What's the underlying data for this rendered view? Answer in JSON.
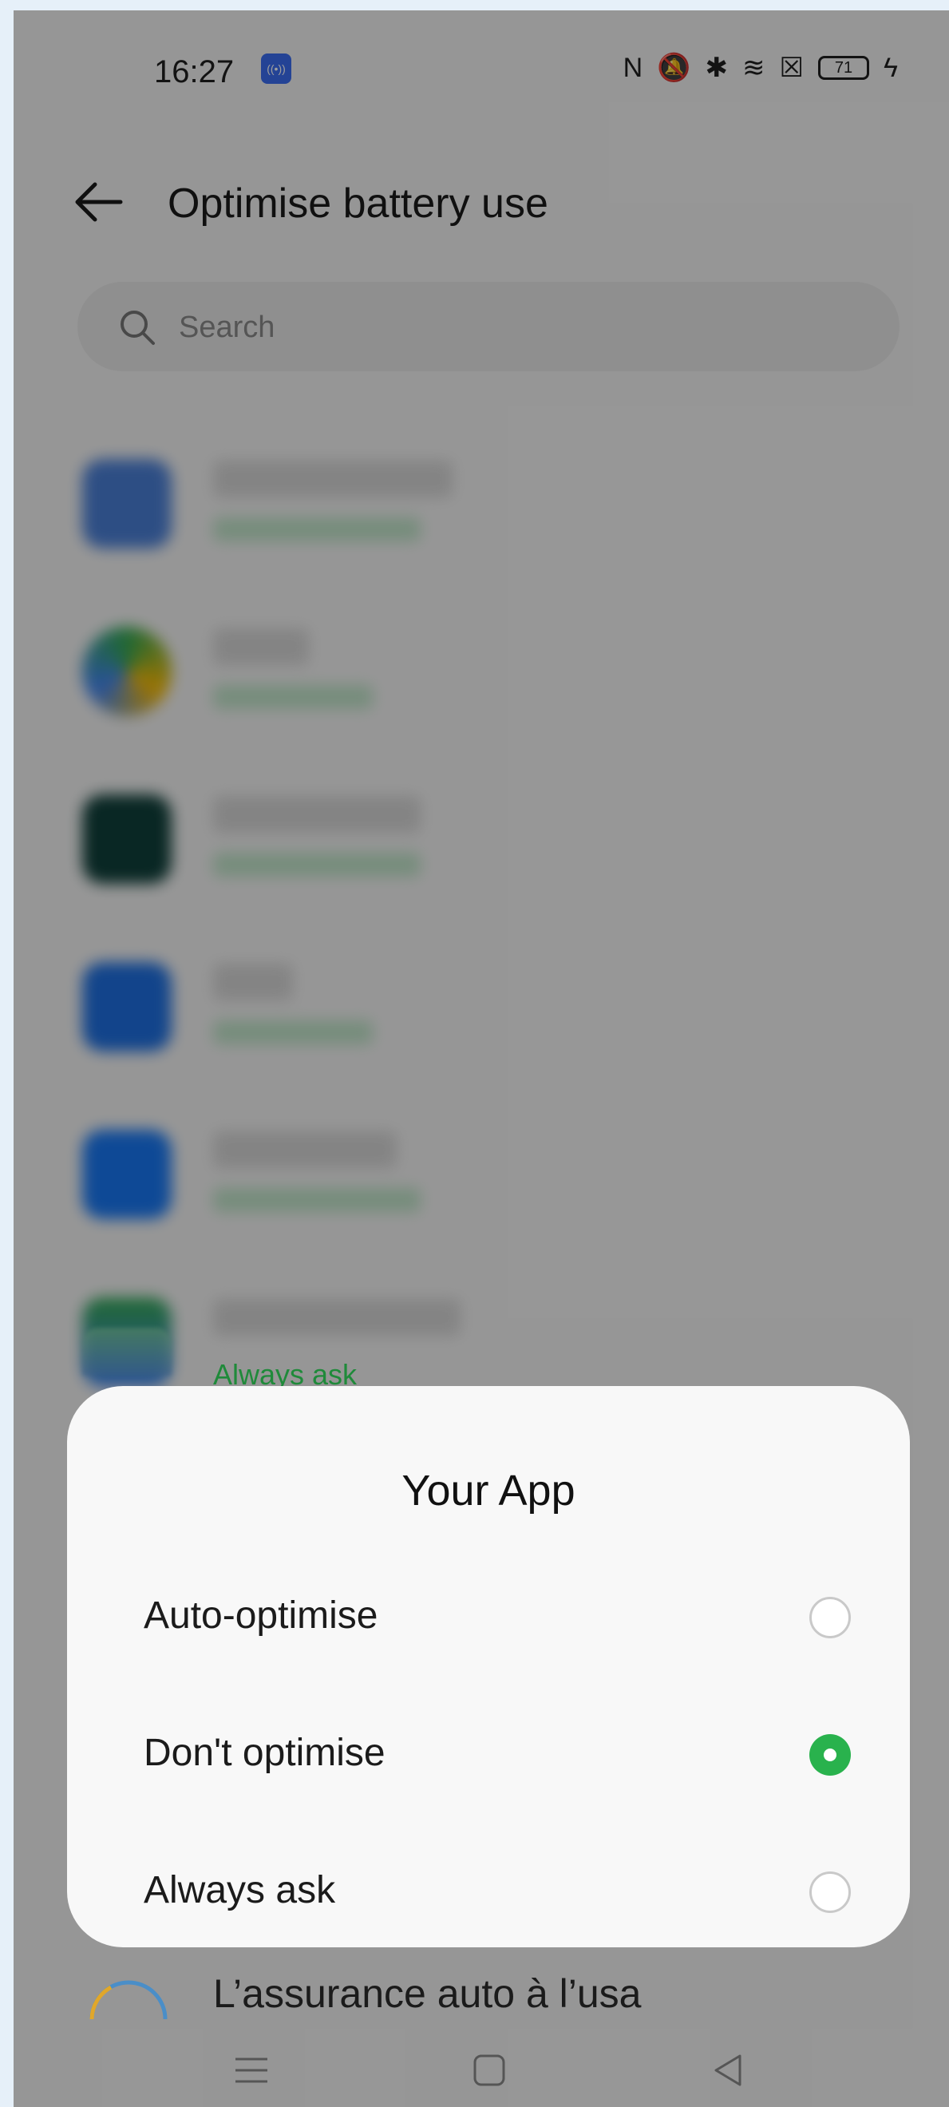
{
  "status_bar": {
    "time": "16:27",
    "battery": "71",
    "icons": [
      "cast-icon",
      "nfc-icon",
      "mute-icon",
      "bluetooth-icon",
      "wifi-icon",
      "sim-icon",
      "battery-icon",
      "charging-icon"
    ]
  },
  "header": {
    "title": "Optimise battery use",
    "back_icon": "back-arrow-icon"
  },
  "search": {
    "placeholder": "Search"
  },
  "list": {
    "peek_status": "Always ask",
    "bottom_app_name": "L’assurance auto à l’usa"
  },
  "dialog": {
    "title": "Your App",
    "options": [
      {
        "label": "Auto-optimise",
        "selected": false
      },
      {
        "label": "Don't optimise",
        "selected": true
      },
      {
        "label": "Always ask",
        "selected": false
      }
    ]
  },
  "colors": {
    "accent": "#29b24d",
    "status_green": "#2aa54a",
    "dim_overlay": "rgba(0,0,0,0.38)"
  },
  "nav_bar": {
    "icons": [
      "menu-icon",
      "home-icon",
      "back-icon"
    ]
  }
}
